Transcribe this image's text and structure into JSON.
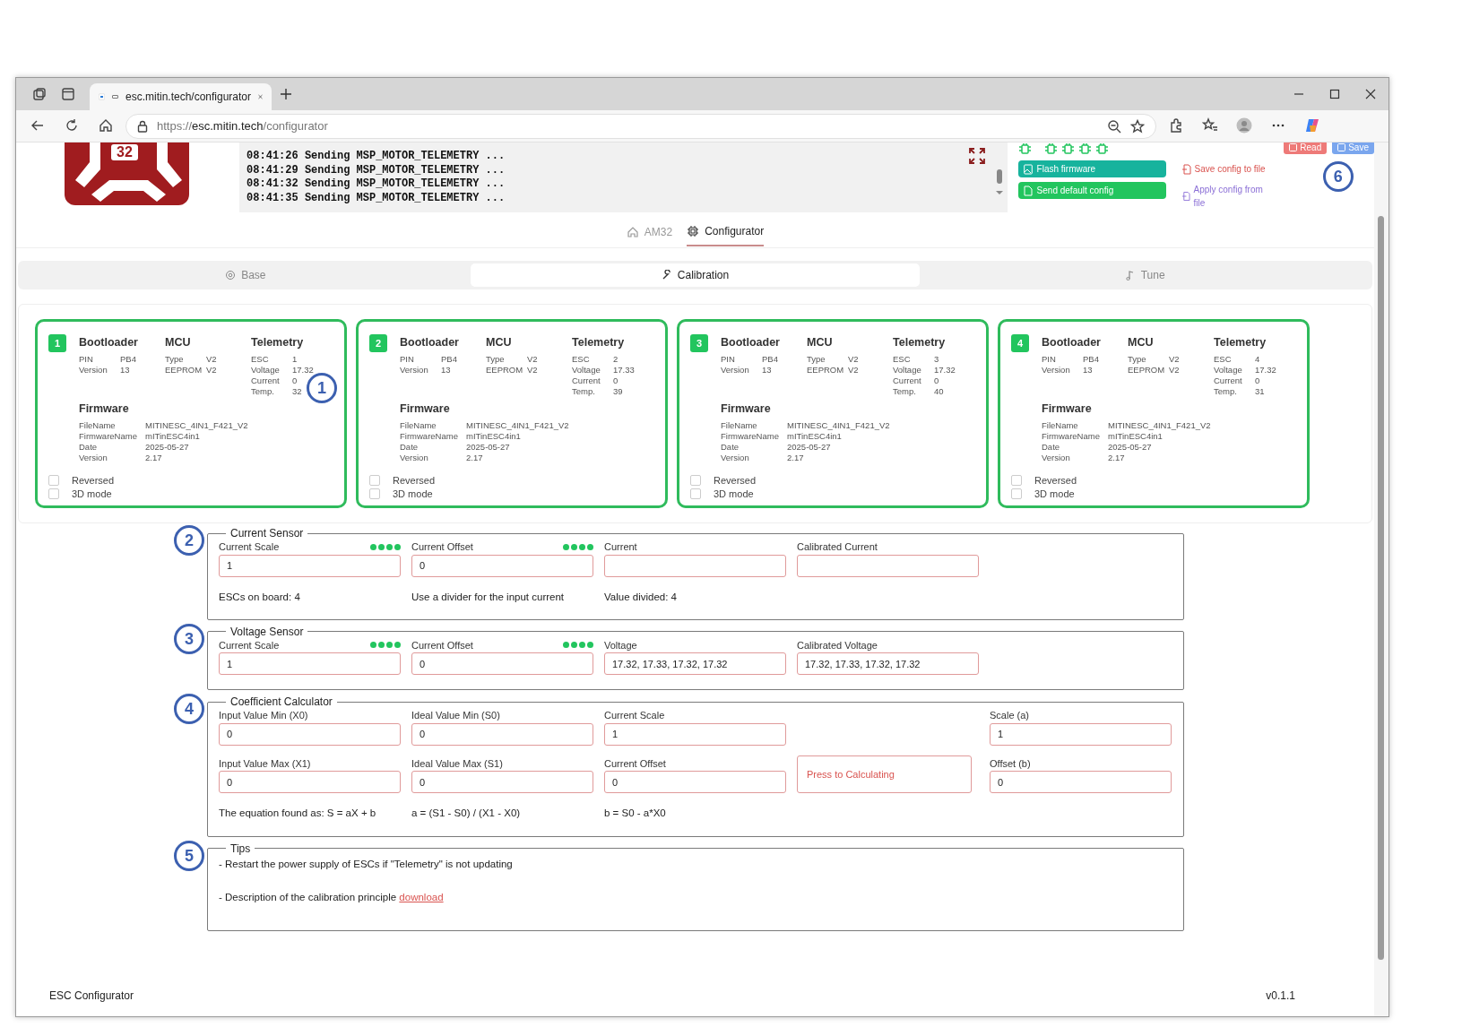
{
  "browser": {
    "tab_title": "esc.mitin.tech/configurator",
    "url_scheme": "https://",
    "url_host": "esc.mitin.tech",
    "url_path": "/configurator"
  },
  "logo": {
    "text": "32"
  },
  "log": {
    "lines": [
      "08:41:26 Sending MSP_MOTOR_TELEMETRY ...",
      "08:41:29 Sending MSP_MOTOR_TELEMETRY ...",
      "08:41:32 Sending MSP_MOTOR_TELEMETRY ...",
      "08:41:35 Sending MSP_MOTOR_TELEMETRY ..."
    ]
  },
  "firmware_buttons": [
    {
      "label": "Flash firmware",
      "kind": "flash"
    },
    {
      "label": "Send default config",
      "kind": "default"
    }
  ],
  "file_links": [
    {
      "label": "Save config to file",
      "kind": "save"
    },
    {
      "label": "Apply config from file",
      "kind": "apply"
    }
  ],
  "config_buttons": [
    {
      "label": "Read",
      "kind": "read"
    },
    {
      "label": "Save",
      "kind": "save"
    }
  ],
  "top_callout": "6",
  "nav": [
    {
      "label": "AM32",
      "kind": "home",
      "selected": false
    },
    {
      "label": "Configurator",
      "kind": "chip",
      "selected": true
    }
  ],
  "tabs": [
    {
      "label": "Base",
      "kind": "gear",
      "selected": false
    },
    {
      "label": "Calibration",
      "kind": "wrench",
      "selected": true
    },
    {
      "label": "Tune",
      "kind": "note",
      "selected": false
    }
  ],
  "escs": [
    {
      "number": "1",
      "callout": "1",
      "groups": [
        {
          "title": "Bootloader",
          "rows": [
            [
              "PIN",
              "PB4"
            ],
            [
              "Version",
              "13"
            ]
          ]
        },
        {
          "title": "MCU",
          "rows": [
            [
              "Type",
              "V2"
            ],
            [
              "EEPROM",
              "V2"
            ]
          ]
        },
        {
          "title": "Telemetry",
          "rows": [
            [
              "ESC",
              "1"
            ],
            [
              "Voltage",
              "17.32"
            ],
            [
              "Current",
              "0"
            ],
            [
              "Temp.",
              "32"
            ]
          ]
        }
      ],
      "firmware": {
        "title": "Firmware",
        "rows": [
          [
            "FileName",
            "MITINESC_4IN1_F421_V2"
          ],
          [
            "FirmwareName",
            "mITinESC4in1"
          ],
          [
            "Date",
            "2025-05-27"
          ],
          [
            "Version",
            "2.17"
          ]
        ]
      },
      "options": [
        {
          "label": "Reversed",
          "checked": false
        },
        {
          "label": "3D mode",
          "checked": false
        }
      ]
    },
    {
      "number": "2",
      "groups": [
        {
          "title": "Bootloader",
          "rows": [
            [
              "PIN",
              "PB4"
            ],
            [
              "Version",
              "13"
            ]
          ]
        },
        {
          "title": "MCU",
          "rows": [
            [
              "Type",
              "V2"
            ],
            [
              "EEPROM",
              "V2"
            ]
          ]
        },
        {
          "title": "Telemetry",
          "rows": [
            [
              "ESC",
              "2"
            ],
            [
              "Voltage",
              "17.33"
            ],
            [
              "Current",
              "0"
            ],
            [
              "Temp.",
              "39"
            ]
          ]
        }
      ],
      "firmware": {
        "title": "Firmware",
        "rows": [
          [
            "FileName",
            "MITINESC_4IN1_F421_V2"
          ],
          [
            "FirmwareName",
            "mITinESC4in1"
          ],
          [
            "Date",
            "2025-05-27"
          ],
          [
            "Version",
            "2.17"
          ]
        ]
      },
      "options": [
        {
          "label": "Reversed",
          "checked": false
        },
        {
          "label": "3D mode",
          "checked": false
        }
      ]
    },
    {
      "number": "3",
      "groups": [
        {
          "title": "Bootloader",
          "rows": [
            [
              "PIN",
              "PB4"
            ],
            [
              "Version",
              "13"
            ]
          ]
        },
        {
          "title": "MCU",
          "rows": [
            [
              "Type",
              "V2"
            ],
            [
              "EEPROM",
              "V2"
            ]
          ]
        },
        {
          "title": "Telemetry",
          "rows": [
            [
              "ESC",
              "3"
            ],
            [
              "Voltage",
              "17.32"
            ],
            [
              "Current",
              "0"
            ],
            [
              "Temp.",
              "40"
            ]
          ]
        }
      ],
      "firmware": {
        "title": "Firmware",
        "rows": [
          [
            "FileName",
            "MITINESC_4IN1_F421_V2"
          ],
          [
            "FirmwareName",
            "mITinESC4in1"
          ],
          [
            "Date",
            "2025-05-27"
          ],
          [
            "Version",
            "2.17"
          ]
        ]
      },
      "options": [
        {
          "label": "Reversed",
          "checked": false
        },
        {
          "label": "3D mode",
          "checked": false
        }
      ]
    },
    {
      "number": "4",
      "groups": [
        {
          "title": "Bootloader",
          "rows": [
            [
              "PIN",
              "PB4"
            ],
            [
              "Version",
              "13"
            ]
          ]
        },
        {
          "title": "MCU",
          "rows": [
            [
              "Type",
              "V2"
            ],
            [
              "EEPROM",
              "V2"
            ]
          ]
        },
        {
          "title": "Telemetry",
          "rows": [
            [
              "ESC",
              "4"
            ],
            [
              "Voltage",
              "17.32"
            ],
            [
              "Current",
              "0"
            ],
            [
              "Temp.",
              "31"
            ]
          ]
        }
      ],
      "firmware": {
        "title": "Firmware",
        "rows": [
          [
            "FileName",
            "MITINESC_4IN1_F421_V2"
          ],
          [
            "FirmwareName",
            "mITinESC4in1"
          ],
          [
            "Date",
            "2025-05-27"
          ],
          [
            "Version",
            "2.17"
          ]
        ]
      },
      "options": [
        {
          "label": "Reversed",
          "checked": false
        },
        {
          "label": "3D mode",
          "checked": false
        }
      ]
    }
  ],
  "sections": [
    {
      "title": "Current Sensor",
      "callout": "2",
      "columns": [
        [
          {
            "kind": "field",
            "label": "Current Scale",
            "value": "1",
            "dots": [
              {
                "ok": true
              },
              {
                "ok": true
              },
              {
                "ok": true
              },
              {
                "ok": true
              }
            ]
          }
        ],
        [
          {
            "kind": "field",
            "label": "Current Offset",
            "value": "0",
            "dots": [
              {
                "ok": true
              },
              {
                "ok": true
              },
              {
                "ok": true
              },
              {
                "ok": true
              }
            ]
          }
        ],
        [
          {
            "kind": "field",
            "label": "Current"
          }
        ],
        [
          {
            "kind": "field",
            "label": "Calibrated Current"
          }
        ]
      ],
      "notes": [
        "ESCs on board: 4",
        "Use a divider for the input current",
        "Value divided: 4"
      ]
    },
    {
      "title": "Voltage Sensor",
      "callout": "3",
      "columns": [
        [
          {
            "kind": "field",
            "label": "Current Scale",
            "value": "1",
            "dots": [
              {
                "ok": true
              },
              {
                "ok": true
              },
              {
                "ok": true
              },
              {
                "ok": true
              }
            ]
          }
        ],
        [
          {
            "kind": "field",
            "label": "Current Offset",
            "value": "0",
            "dots": [
              {
                "ok": true
              },
              {
                "ok": true
              },
              {
                "ok": true
              },
              {
                "ok": true
              }
            ]
          }
        ],
        [
          {
            "kind": "field",
            "label": "Voltage",
            "value": "17.32, 17.33, 17.32, 17.32"
          }
        ],
        [
          {
            "kind": "field",
            "label": "Calibrated Voltage",
            "value": "17.32, 17.33, 17.32, 17.32"
          }
        ]
      ]
    },
    {
      "title": "Coefficient Calculator",
      "callout": "4",
      "columns": [
        [
          {
            "kind": "field",
            "label": "Input Value Min (X0)",
            "value": "0"
          },
          {
            "kind": "field",
            "label": "Input Value Max (X1)",
            "value": "0"
          }
        ],
        [
          {
            "kind": "field",
            "label": "Ideal Value Min (S0)",
            "value": "0"
          },
          {
            "kind": "field",
            "label": "Ideal Value Max (S1)",
            "value": "0"
          }
        ],
        [
          {
            "kind": "field",
            "label": "Current Scale",
            "value": "1"
          },
          {
            "kind": "field",
            "label": "Current Offset",
            "value": "0"
          }
        ],
        [
          {
            "kind": "button",
            "label": "Press to Calculating"
          }
        ],
        [
          {
            "kind": "field",
            "label": "Scale (a)",
            "value": "1"
          },
          {
            "kind": "field",
            "label": "Offset (b)",
            "value": "0"
          }
        ]
      ],
      "notes": [
        "The equation found as: S = aX + b",
        "a = (S1 - S0) / (X1 - X0)",
        "b = S0 - a*X0"
      ]
    },
    {
      "title": "Tips",
      "callout": "5",
      "tips": [
        {
          "text": "- Restart the power supply of ESCs if \"Telemetry\" is not updating"
        },
        {
          "text": "- Description of the calibration principle",
          "link": "download"
        }
      ]
    }
  ],
  "footer": {
    "left": "ESC Configurator",
    "right": "v0.1.1"
  }
}
